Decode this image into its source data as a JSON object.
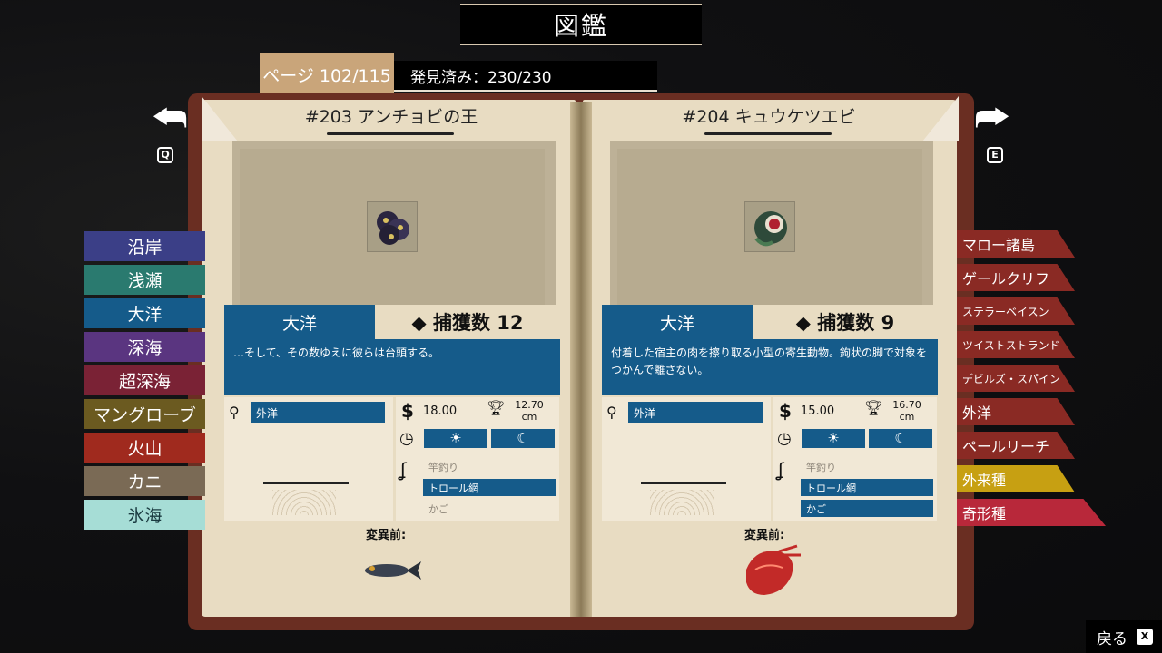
{
  "header": {
    "title": "図鑑",
    "page": "ページ 102/115",
    "discovered": "発見済み：230/230"
  },
  "nav": {
    "prev_key": "Q",
    "next_key": "E",
    "back_label": "戻る",
    "back_key": "X"
  },
  "left_tabs": [
    {
      "label": "沿岸",
      "color": "#3b3f87"
    },
    {
      "label": "浅瀬",
      "color": "#2a7a6f"
    },
    {
      "label": "大洋",
      "color": "#155b8a"
    },
    {
      "label": "深海",
      "color": "#5a3580"
    },
    {
      "label": "超深海",
      "color": "#7a2235"
    },
    {
      "label": "マングローブ",
      "color": "#6b5a20"
    },
    {
      "label": "火山",
      "color": "#a02a1e"
    },
    {
      "label": "カニ",
      "color": "#7a6a55"
    },
    {
      "label": "氷海",
      "color": "#a6ddd6",
      "text": "#1a3a40"
    }
  ],
  "right_tabs": [
    {
      "label": "マロー諸島",
      "color": "#8a2a24"
    },
    {
      "label": "ゲールクリフ",
      "color": "#8a2a24"
    },
    {
      "label": "ステラーベイスン",
      "color": "#8a2a24"
    },
    {
      "label": "ツイストストランド",
      "color": "#8a2a24"
    },
    {
      "label": "デビルズ・スパイン",
      "color": "#8a2a24"
    },
    {
      "label": "外洋",
      "color": "#8a2a24"
    },
    {
      "label": "ペールリーチ",
      "color": "#8a2a24"
    },
    {
      "label": "外来種",
      "color": "#c7a012"
    },
    {
      "label": "奇形種",
      "color": "#b8283a"
    }
  ],
  "left_page": {
    "title": "#203 アンチョビの王",
    "habitat": "大洋",
    "catch": "◆ 捕獲数 12",
    "description": "…そして、その数ゆえに彼らは台頭する。",
    "location": "外洋",
    "price_symbol": "$",
    "price": "18.00",
    "trophy_value": "12.70",
    "trophy_unit": "cm",
    "gear": [
      {
        "label": "竿釣り",
        "active": false
      },
      {
        "label": "トロール網",
        "active": true
      },
      {
        "label": "かご",
        "active": false
      }
    ],
    "mutation_label": "変異前:"
  },
  "right_page": {
    "title": "#204 キュウケツエビ",
    "habitat": "大洋",
    "catch": "◆ 捕獲数 9",
    "description": "付着した宿主の肉を擦り取る小型の寄生動物。鉤状の脚で対象をつかんで離さない。",
    "location": "外洋",
    "price_symbol": "$",
    "price": "15.00",
    "trophy_value": "16.70",
    "trophy_unit": "cm",
    "gear": [
      {
        "label": "竿釣り",
        "active": false
      },
      {
        "label": "トロール網",
        "active": true
      },
      {
        "label": "かご",
        "active": true
      }
    ],
    "mutation_label": "変異前:"
  }
}
